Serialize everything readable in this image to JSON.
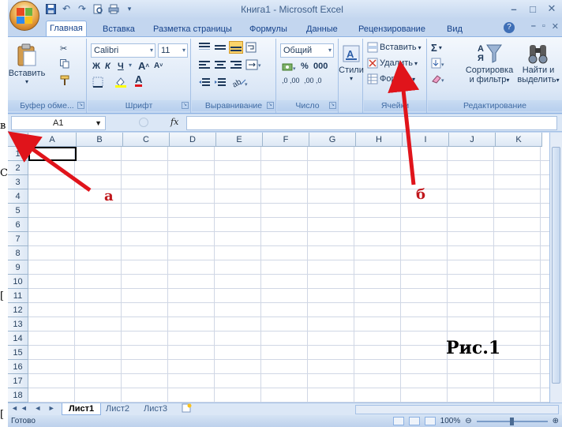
{
  "window": {
    "title": "Книга1 - Microsoft Excel"
  },
  "tabs": [
    {
      "label": "Главная",
      "active": true
    },
    {
      "label": "Вставка"
    },
    {
      "label": "Разметка страницы"
    },
    {
      "label": "Формулы"
    },
    {
      "label": "Данные"
    },
    {
      "label": "Рецензирование"
    },
    {
      "label": "Вид"
    }
  ],
  "ribbon": {
    "clipboard": {
      "paste": "Вставить",
      "label": "Буфер обме..."
    },
    "font": {
      "name": "Calibri",
      "size": "11",
      "label": "Шрифт",
      "bold": "Ж",
      "italic": "К",
      "underline": "Ч"
    },
    "alignment": {
      "label": "Выравнивание"
    },
    "number": {
      "format": "Общий",
      "percent": "%",
      "thousands": "000",
      "inc_decimal": ",0 ,00",
      "dec_decimal": ",00 ,0",
      "label": "Число"
    },
    "styles": {
      "label": "Стили"
    },
    "cells": {
      "insert": "Вставить",
      "delete": "Удалить",
      "format": "Формат",
      "label": "Ячейки"
    },
    "editing": {
      "sort": "Сортировка",
      "sort2": "и фильтр",
      "find": "Найти и",
      "find2": "выделить",
      "label": "Редактирование"
    }
  },
  "formula_bar": {
    "name_box": "A1",
    "fx": "fx",
    "value": ""
  },
  "grid": {
    "columns": [
      "A",
      "B",
      "C",
      "D",
      "E",
      "F",
      "G",
      "H",
      "I",
      "J",
      "K"
    ],
    "rows": [
      "1",
      "2",
      "3",
      "4",
      "5",
      "6",
      "7",
      "8",
      "9",
      "10",
      "11",
      "12",
      "13",
      "14",
      "15",
      "16",
      "17",
      "18"
    ]
  },
  "sheets": [
    {
      "label": "Лист1",
      "active": true
    },
    {
      "label": "Лист2"
    },
    {
      "label": "Лист3"
    }
  ],
  "status": {
    "ready": "Готово",
    "zoom": "100%"
  },
  "annotations": {
    "label_a": "а",
    "label_b": "б",
    "caption": "Рис.1",
    "arrow_color": "#e0141b"
  },
  "edge_fragments": [
    "в",
    "С",
    "[",
    "["
  ]
}
